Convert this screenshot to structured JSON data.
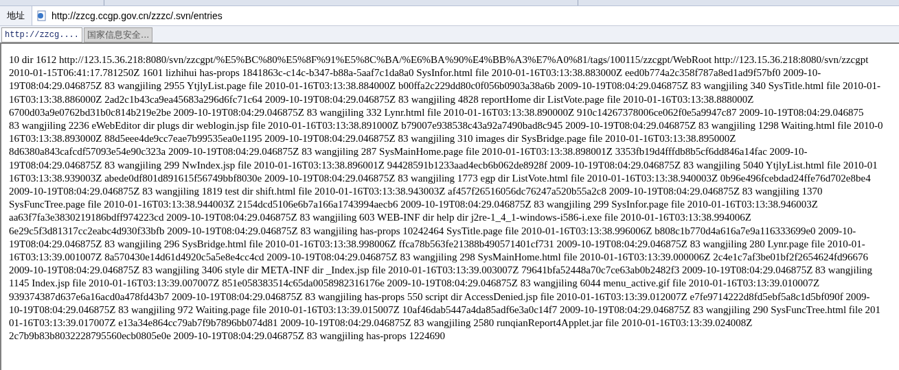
{
  "address_bar": {
    "label": "地址",
    "url": "http://zzcg.ccgp.gov.cn/zzzc/.svn/entries"
  },
  "tabs": [
    {
      "label": "http://zzcg....",
      "selected": true
    },
    {
      "label": "国家信息安全...",
      "selected": false
    }
  ],
  "page_lines": [
    "10 dir 1612 http://123.15.36.218:8080/svn/zzcgpt/%E5%BC%80%E5%8F%91%E5%8C%BA/%E6%BA%90%E4%BB%A3%E7%A0%81/tags/100115/zzcgpt/WebRoot http://123.15.36.218:8080/svn/zzcgpt",
    "2010-01-15T06:41:17.781250Z 1601 lizhihui has-props 1841863c-c14c-b347-b88a-5aaf7c1da8a0 SysInfor.html file 2010-01-16T03:13:38.883000Z eed0b774a2c358f787a8ed1ad9f57bf0 2009-10-",
    "19T08:04:29.046875Z 83 wangjiling 2955 YtjlyList.page file 2010-01-16T03:13:38.884000Z b00ffa2c229dd80c0f056b0903a38a6b 2009-10-19T08:04:29.046875Z 83 wangjiling 340 SysTitle.html file 2010-01-",
    "16T03:13:38.886000Z 2ad2c1b43ca9ea45683a296d6fc71c64 2009-10-19T08:04:29.046875Z 83 wangjiling 4828 reportHome dir ListVote.page file 2010-01-16T03:13:38.888000Z",
    "6700d03a9e0762bd31b0c814b219e2be 2009-10-19T08:04:29.046875Z 83 wangjiling 332 Lynr.html file 2010-01-16T03:13:38.890000Z 910c14267378006ce062f0e5a9947c87 2009-10-19T08:04:29.046875",
    "83 wangjiling 2236 eWebEditor dir plugs dir weblogin.jsp file 2010-01-16T03:13:38.891000Z b79007e938538c43a92a7490bad8c945 2009-10-19T08:04:29.046875Z 83 wangjiling 1298 Waiting.html file 2010-0",
    "16T03:13:38.893000Z 88d5eee4de9cc7eae7b99535ea0e1195 2009-10-19T08:04:29.046875Z 83 wangjiling 310 images dir SysBridge.page file 2010-01-16T03:13:38.895000Z",
    "8d6380a843cafcdf57093e54e90c323a 2009-10-19T08:04:29.046875Z 83 wangjiling 287 SysMainHome.page file 2010-01-16T03:13:38.898001Z 3353fb19d4fffdb8b5cf6dd846a14fac 2009-10-",
    "19T08:04:29.046875Z 83 wangjiling 299 NwIndex.jsp file 2010-01-16T03:13:38.896001Z 94428591b1233aad4ecb6b062de8928f 2009-10-19T08:04:29.046875Z 83 wangjiling 5040 YtjlyList.html file 2010-01",
    "16T03:13:38.939003Z abede0df801d891615f56749bbf8030e 2009-10-19T08:04:29.046875Z 83 wangjiling 1773 egp dir ListVote.html file 2010-01-16T03:13:38.940003Z 0b96e496fcebdad24ffe76d702e8be4",
    "2009-10-19T08:04:29.046875Z 83 wangjiling 1819 test dir shift.html file 2010-01-16T03:13:38.943003Z af457f26516056dc76247a520b55a2c8 2009-10-19T08:04:29.046875Z 83 wangjiling 1370",
    "SysFuncTree.page file 2010-01-16T03:13:38.944003Z 2154dcd5106e6b7a166a1743994aecb6 2009-10-19T08:04:29.046875Z 83 wangjiling 299 SysInfor.page file 2010-01-16T03:13:38.946003Z",
    "aa63f7fa3e3830219186bdff974223cd 2009-10-19T08:04:29.046875Z 83 wangjiling 603 WEB-INF dir help dir j2re-1_4_1-windows-i586-i.exe file 2010-01-16T03:13:38.994006Z",
    "6e29c5f3d81317cc2eabc4d930f33bfb 2009-10-19T08:04:29.046875Z 83 wangjiling has-props 10242464 SysTitle.page file 2010-01-16T03:13:38.996006Z b808c1b770d4a616a7e9a116333699e0 2009-10-",
    "19T08:04:29.046875Z 83 wangjiling 296 SysBridge.html file 2010-01-16T03:13:38.998006Z ffca78b563fe21388b490571401cf731 2009-10-19T08:04:29.046875Z 83 wangjiling 280 Lynr.page file 2010-01-",
    "16T03:13:39.001007Z 8a570430e14d61d4920c5a5e8e4cc4cd 2009-10-19T08:04:29.046875Z 83 wangjiling 298 SysMainHome.html file 2010-01-16T03:13:39.000006Z 2c4e1c7af3be01bf2f2654624fd96676",
    "2009-10-19T08:04:29.046875Z 83 wangjiling 3406 style dir META-INF dir _Index.jsp file 2010-01-16T03:13:39.003007Z 79641bfa52448a70c7ce63ab0b2482f3 2009-10-19T08:04:29.046875Z 83 wangjiling",
    "1145 Index.jsp file 2010-01-16T03:13:39.007007Z 851e058383514c65da0058982316176e 2009-10-19T08:04:29.046875Z 83 wangjiling 6044 menu_active.gif file 2010-01-16T03:13:39.010007Z",
    "939374387d637e6a16acd0a478fd43b7 2009-10-19T08:04:29.046875Z 83 wangjiling has-props 550 script dir AccessDenied.jsp file 2010-01-16T03:13:39.012007Z e7fe9714222d8fd5ebf5a8c1d5bf090f 2009-",
    "10-19T08:04:29.046875Z 83 wangjiling 972 Waiting.page file 2010-01-16T03:13:39.015007Z 10af46dab5447a4da85adf6e3a0c14f7 2009-10-19T08:04:29.046875Z 83 wangjiling 290 SysFuncTree.html file 201",
    "01-16T03:13:39.017007Z e13a34e864cc79ab7f9b7896bb074d81 2009-10-19T08:04:29.046875Z 83 wangjiling 2580 runqianReport4Applet.jar file 2010-01-16T03:13:39.024008Z",
    "2c7b9b83b8032228795560ecb0805e0e 2009-10-19T08:04:29.046875Z 83 wangjiling has-props 1224690"
  ]
}
